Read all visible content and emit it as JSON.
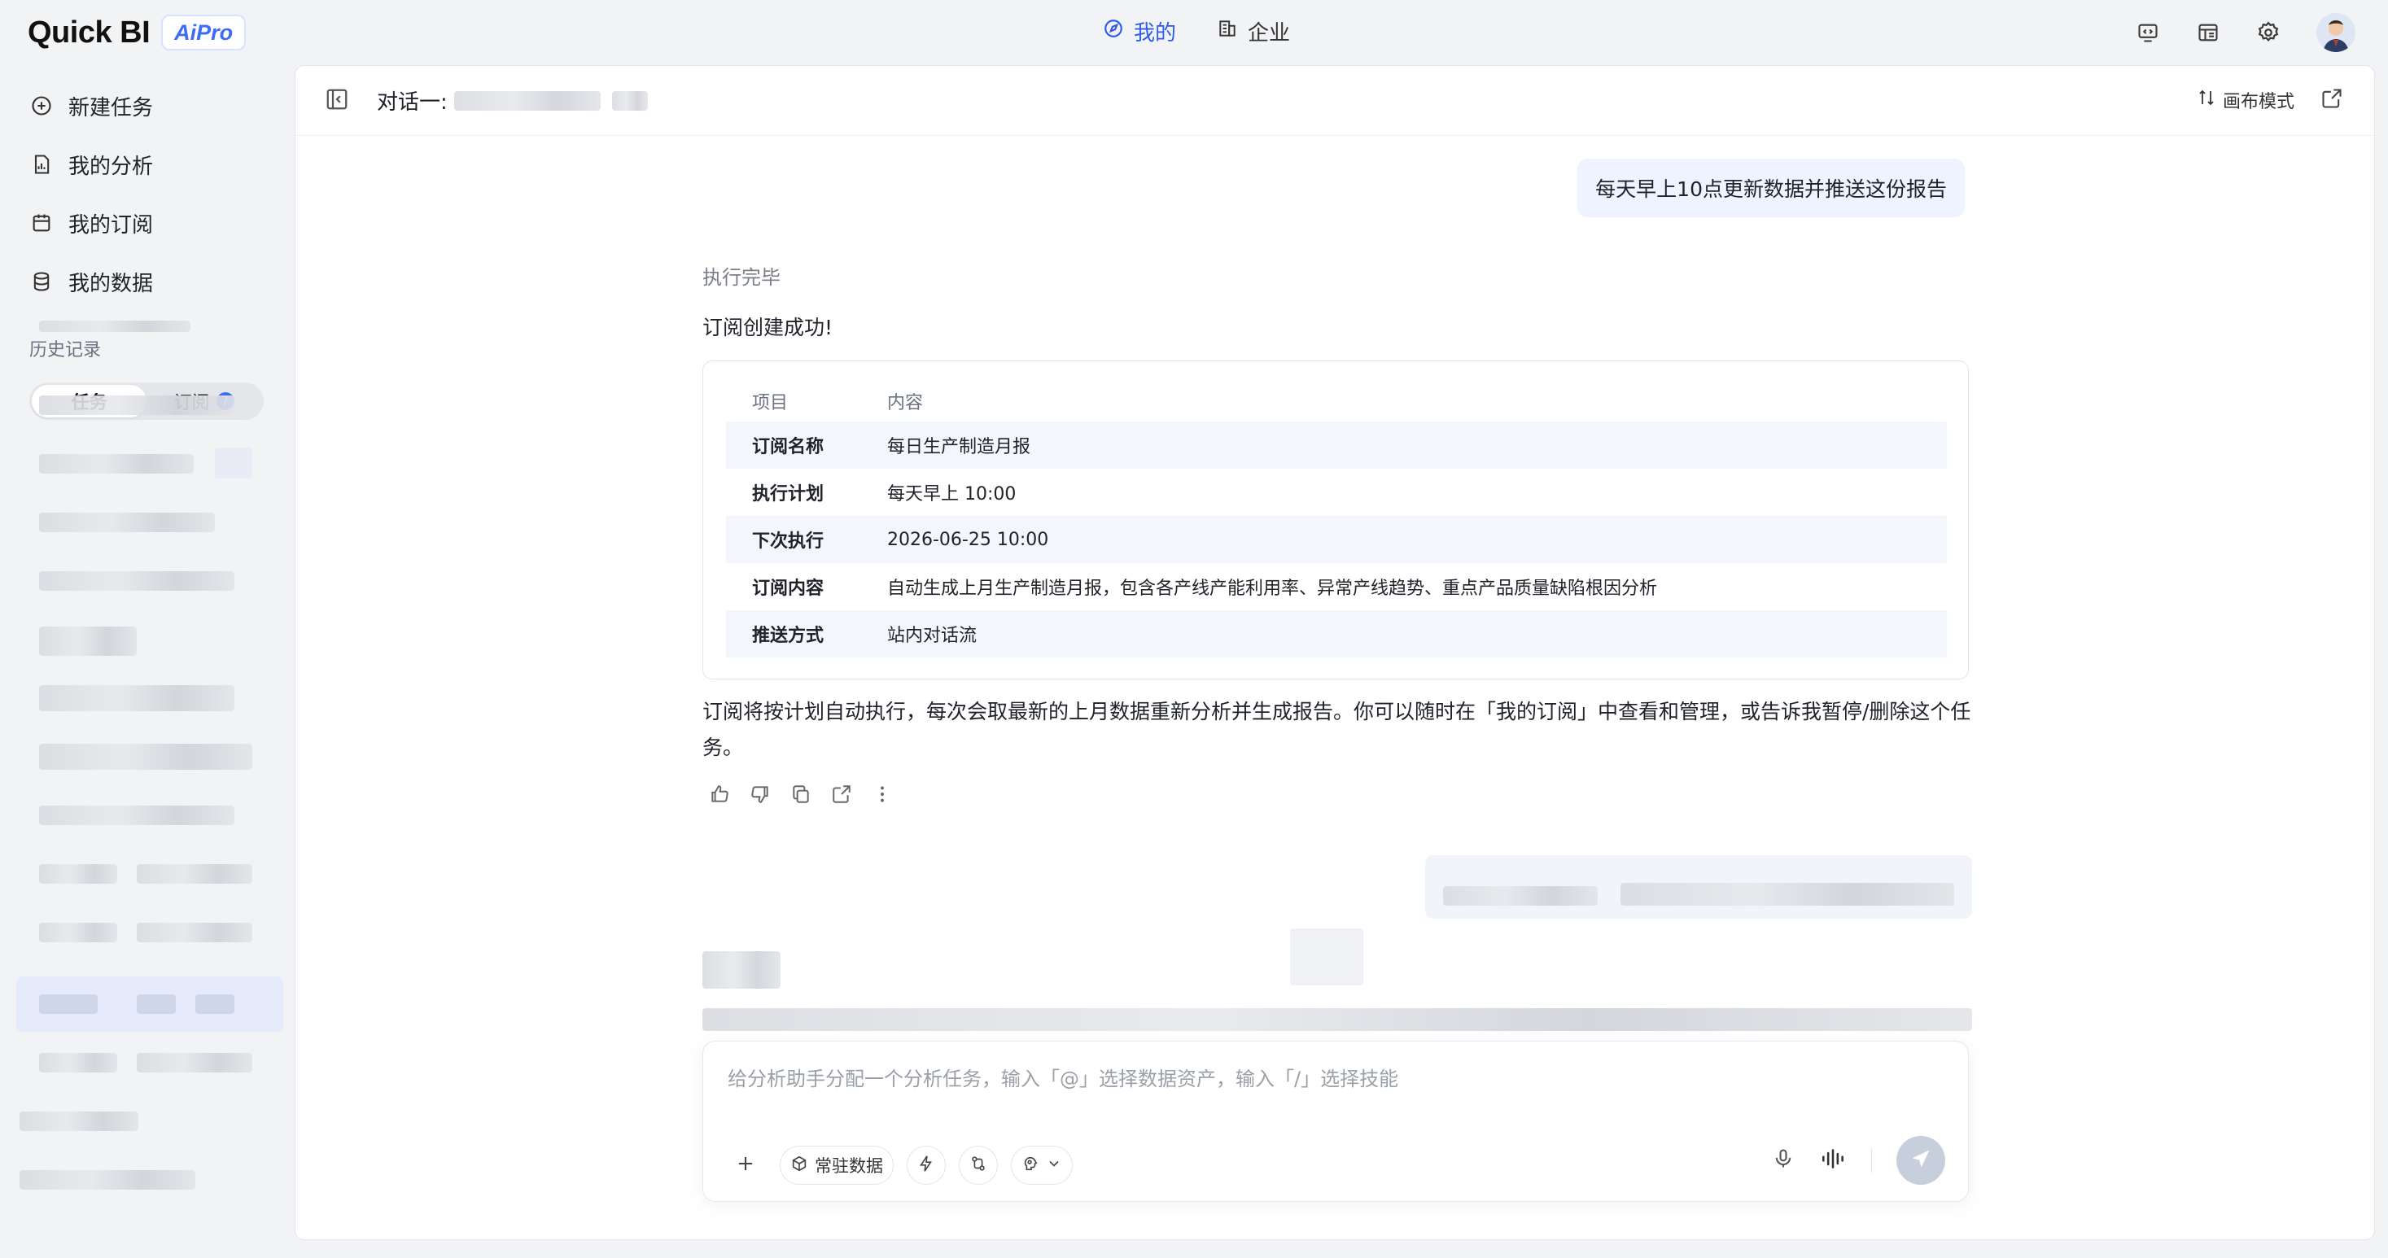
{
  "brand": {
    "name": "Quick BI",
    "badge": "AiPro"
  },
  "top_nav": [
    {
      "label": "我的",
      "active": true
    },
    {
      "label": "企业",
      "active": false
    }
  ],
  "sidebar": {
    "items": [
      {
        "label": "新建任务",
        "icon": "plus-circle-icon"
      },
      {
        "label": "我的分析",
        "icon": "file-chart-icon"
      },
      {
        "label": "我的订阅",
        "icon": "calendar-icon"
      },
      {
        "label": "我的数据",
        "icon": "database-icon"
      }
    ],
    "history_label": "历史记录",
    "history_tabs": [
      {
        "label": "任务",
        "active": true
      },
      {
        "label": "订阅",
        "count": "7",
        "active": false
      }
    ]
  },
  "conversation": {
    "title": "对话一:",
    "canvas_mode_label": "画布模式",
    "user_message": "每天早上10点更新数据并推送这份报告",
    "status": "执行完毕",
    "success": "订阅创建成功!",
    "table": {
      "headers": [
        "项目",
        "内容"
      ],
      "rows": [
        {
          "key": "订阅名称",
          "value": "每日生产制造月报"
        },
        {
          "key": "执行计划",
          "value": "每天早上 10:00"
        },
        {
          "key": "下次执行",
          "value": "2026-06-25 10:00"
        },
        {
          "key": "订阅内容",
          "value": "自动生成上月生产制造月报，包含各产线产能利用率、异常产线趋势、重点产品质量缺陷根因分析"
        },
        {
          "key": "推送方式",
          "value": "站内对话流"
        }
      ]
    },
    "description": "订阅将按计划自动执行，每次会取最新的上月数据重新分析并生成报告。你可以随时在「我的订阅」中查看和管理，或告诉我暂停/删除这个任务。"
  },
  "composer": {
    "placeholder": "给分析助手分配一个分析任务，输入「@」选择数据资产，输入「/」选择技能",
    "resident_data_label": "常驻数据"
  },
  "colors": {
    "accent": "#2f5bea",
    "badge": "#3d6cf6",
    "bubble": "#eff3ff",
    "row_stripe": "#f3f6fc"
  }
}
